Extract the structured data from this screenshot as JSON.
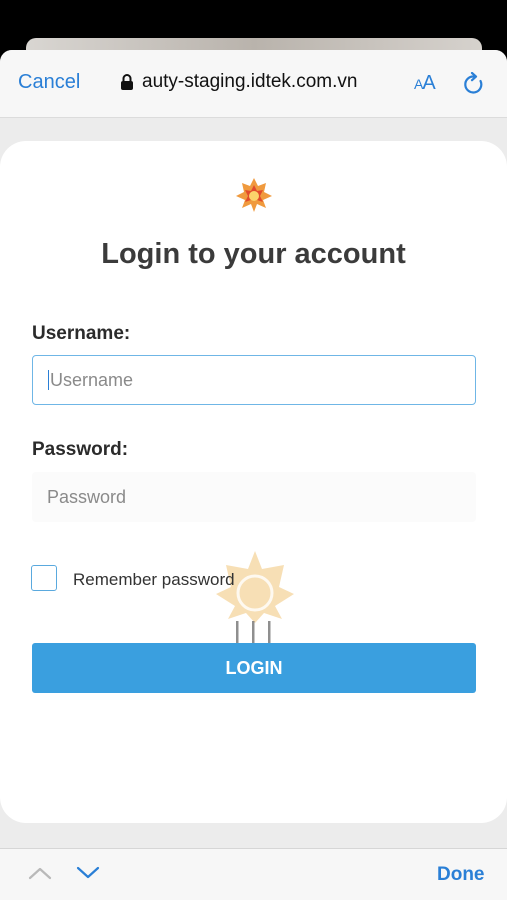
{
  "browser": {
    "cancel_label": "Cancel",
    "url": "auty-staging.idtek.com.vn",
    "text_size_label_small": "A",
    "text_size_label_large": "A",
    "accent_color": "#2a7fd6"
  },
  "login": {
    "title": "Login to your account",
    "username_label": "Username:",
    "username_placeholder": "Username",
    "password_label": "Password:",
    "password_placeholder": "Password",
    "remember_label": "Remember password",
    "login_button": "LOGIN",
    "button_color": "#3a9fdf"
  },
  "keyboard_toolbar": {
    "done_label": "Done"
  },
  "icons": [
    "lock-icon",
    "reload-icon",
    "brand-logo-icon",
    "chevron-up-icon",
    "chevron-down-icon"
  ]
}
